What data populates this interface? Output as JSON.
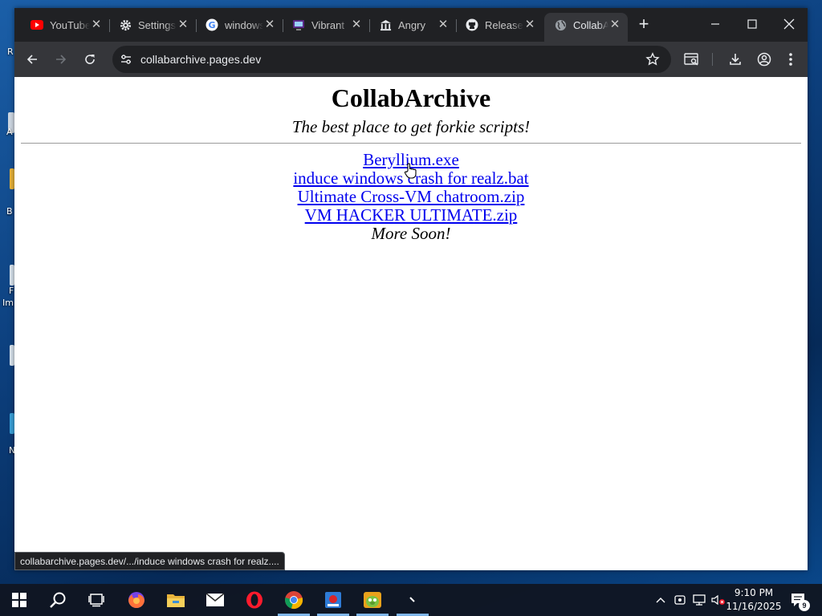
{
  "tabs": [
    {
      "title": "YouTube",
      "icon": "youtube-icon"
    },
    {
      "title": "Settings",
      "icon": "gear-icon"
    },
    {
      "title": "windows",
      "icon": "google-icon"
    },
    {
      "title": "Vibrant",
      "icon": "vibrant-icon"
    },
    {
      "title": "Angry",
      "icon": "museum-icon"
    },
    {
      "title": "Releases",
      "icon": "github-icon"
    },
    {
      "title": "CollabArchive",
      "icon": "globe-icon",
      "active": true
    }
  ],
  "address_bar": {
    "url": "collabarchive.pages.dev"
  },
  "page": {
    "title": "CollabArchive",
    "tagline": "The best place to get forkie scripts!",
    "links": [
      "Beryllium.exe",
      "induce windows crash for realz.bat",
      "Ultimate Cross-VM chatroom.zip",
      "VM HACKER ULTIMATE.zip"
    ],
    "more": "More Soon!"
  },
  "status_bar": {
    "text": "collabarchive.pages.dev/.../induce windows crash for realz...."
  },
  "desktop_labels": [
    "R",
    "A",
    "B",
    "F",
    "Im",
    "N"
  ],
  "taskbar": {
    "apps": [
      "start-icon",
      "search-icon",
      "task-view-icon",
      "firefox-icon",
      "file-explorer-icon",
      "mail-icon",
      "opera-icon",
      "chrome-icon",
      "app-icon",
      "angry-birds-icon",
      "app-icon"
    ],
    "clock_time": "9:10 PM",
    "clock_date": "11/16/2025",
    "notifications": "9"
  },
  "colors": {
    "link": "#0000ee",
    "tabstrip": "#202124",
    "toolbar": "#35363a",
    "active_indicator": "#7fb6ea"
  }
}
